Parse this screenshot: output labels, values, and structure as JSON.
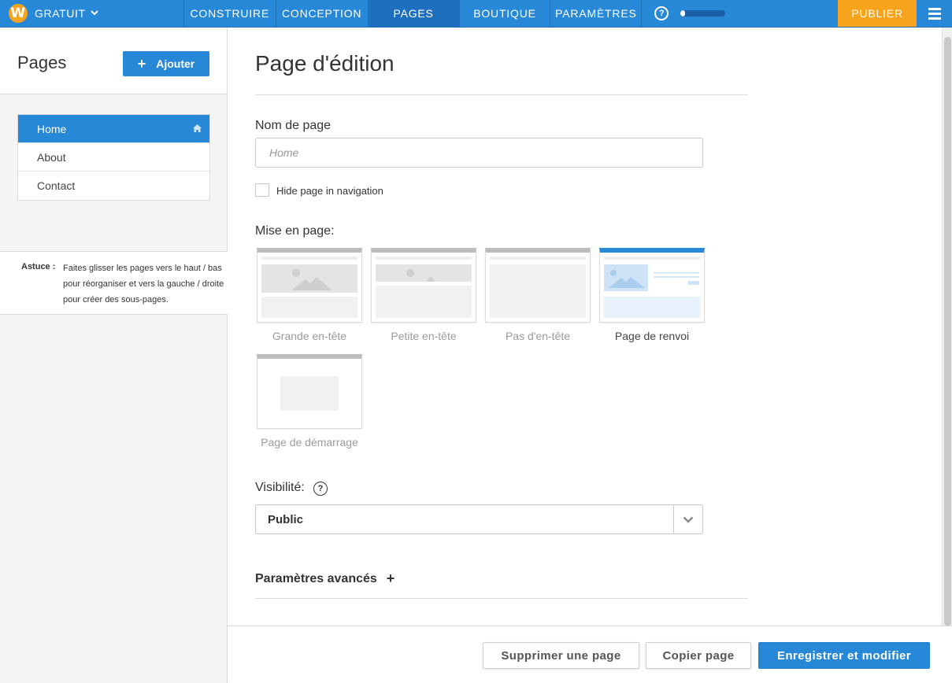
{
  "topbar": {
    "logo_letter": "W",
    "plan_label": "GRATUIT",
    "tabs": [
      {
        "label": "CONSTRUIRE",
        "active": false
      },
      {
        "label": "CONCEPTION",
        "active": false
      },
      {
        "label": "PAGES",
        "active": true
      },
      {
        "label": "BOUTIQUE",
        "active": false
      },
      {
        "label": "PARAMÈTRES",
        "active": false
      }
    ],
    "help_symbol": "?",
    "progress_fraction": 0.1,
    "publish_label": "PUBLIER"
  },
  "sidebar": {
    "title": "Pages",
    "add_label": "Ajouter",
    "pages": [
      {
        "label": "Home",
        "active": true,
        "is_home": true
      },
      {
        "label": "About",
        "active": false
      },
      {
        "label": "Contact",
        "active": false
      }
    ],
    "tip_label": "Astuce :",
    "tip_text": "Faites glisser les pages vers le haut / bas pour réorganiser et vers la gauche / droite pour créer des sous-pages."
  },
  "editor": {
    "title": "Page d'édition",
    "page_name_label": "Nom de page",
    "page_name_placeholder": "Home",
    "hide_label": "Hide page in navigation",
    "hide_checked": false,
    "layout_label": "Mise en page:",
    "layouts": [
      {
        "name": "Grande en-tête",
        "selected": false
      },
      {
        "name": "Petite en-tête",
        "selected": false
      },
      {
        "name": "Pas d'en-tête",
        "selected": false
      },
      {
        "name": "Page de renvoi",
        "selected": true
      },
      {
        "name": "Page de démarrage",
        "selected": false
      }
    ],
    "visibility_label": "Visibilité:",
    "visibility_help": "?",
    "visibility_value": "Public",
    "advanced_label": "Paramètres avancés",
    "advanced_symbol": "+"
  },
  "footer": {
    "delete_label": "Supprimer une page",
    "copy_label": "Copier page",
    "save_label": "Enregistrer et modifier"
  },
  "colors": {
    "accent": "#2888d8",
    "publish": "#f8a31c"
  }
}
